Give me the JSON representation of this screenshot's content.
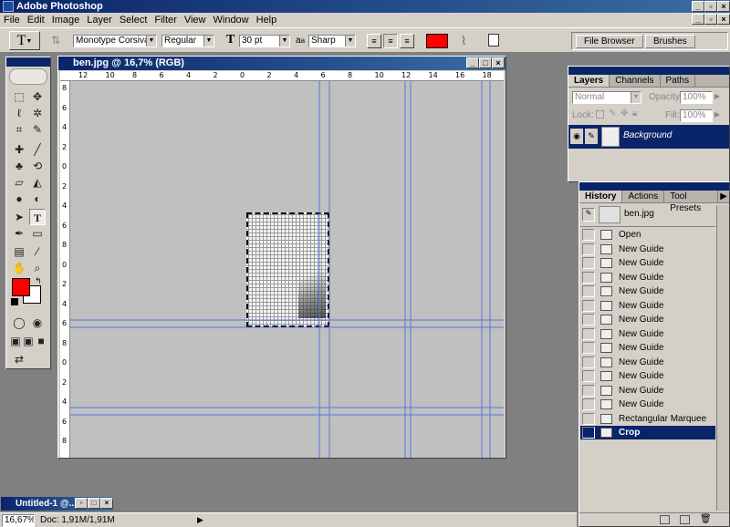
{
  "app": {
    "title": "Adobe Photoshop"
  },
  "menu": [
    "File",
    "Edit",
    "Image",
    "Layer",
    "Select",
    "Filter",
    "View",
    "Window",
    "Help"
  ],
  "options": {
    "font_family": "Monotype Corsiva",
    "font_style": "Regular",
    "font_size": "30 pt",
    "antialias_label": "a",
    "antialias_label2": "a",
    "antialias": "Sharp",
    "text_color": "#ff0000"
  },
  "palette_well": {
    "file_browser": "File Browser",
    "brushes": "Brushes"
  },
  "document": {
    "title": "ben.jpg @ 16,7% (RGB)",
    "hruler": [
      "12",
      "10",
      "8",
      "6",
      "4",
      "2",
      "0",
      "2",
      "4",
      "6",
      "8",
      "10",
      "12",
      "14",
      "16",
      "18"
    ],
    "vruler": [
      "8",
      "6",
      "4",
      "2",
      "0",
      "2",
      "4",
      "6",
      "8",
      "0",
      "2",
      "4",
      "6",
      "8",
      "0",
      "2",
      "4",
      "6",
      "8"
    ]
  },
  "layers": {
    "tabs": [
      "Layers",
      "Channels",
      "Paths"
    ],
    "blend_mode": "Normal",
    "opacity_label": "Opacity:",
    "opacity_value": "100%",
    "lock_label": "Lock:",
    "fill_label": "Fill:",
    "fill_value": "100%",
    "layer_name": "Background"
  },
  "history": {
    "tabs": [
      "History",
      "Actions",
      "Tool Presets"
    ],
    "snapshot": "ben.jpg",
    "items": [
      "Open",
      "New Guide",
      "New Guide",
      "New Guide",
      "New Guide",
      "New Guide",
      "New Guide",
      "New Guide",
      "New Guide",
      "New Guide",
      "New Guide",
      "New Guide",
      "New Guide",
      "Rectangular Marquee",
      "Crop"
    ],
    "selected_index": 14
  },
  "minimized": {
    "title": "Untitled-1 @..."
  },
  "status": {
    "zoom": "16,67%",
    "doc": "Doc: 1,91M/1,91M"
  },
  "colors": {
    "foreground": "#ff0000",
    "background": "#ffffff",
    "titlebar": "#0a246a",
    "guide": "#5577dd"
  }
}
